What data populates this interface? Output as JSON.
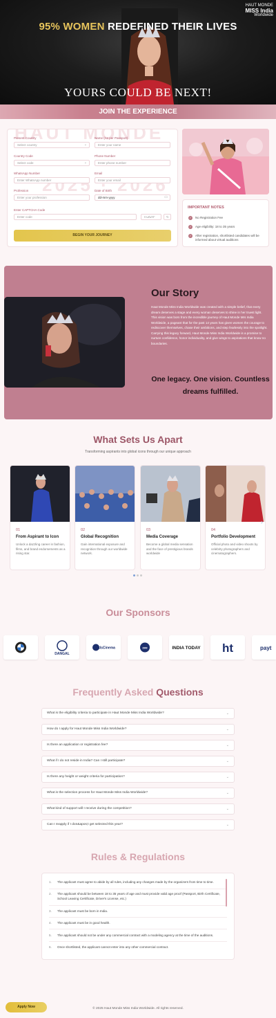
{
  "hero": {
    "headline_highlight": "95% WOMEN",
    "headline_rest": " REDEFINED THEIR LIVES",
    "tagline": "YOURS COULD BE NEXT!",
    "logo_small": "HAUT MONDE",
    "logo_main": "MISS India",
    "logo_sub": "Worldwide"
  },
  "join_banner": "JOIN THE EXPERIENCE",
  "form": {
    "watermark_line1": "HAUT MONDE",
    "watermark_line2": "2025 · 2026",
    "present_country_label": "Present Country",
    "present_country_value": "Select country",
    "name_label": "Name (As per Passport)",
    "name_placeholder": "Enter your name",
    "country_code_label": "Country Code",
    "country_code_value": "Select code",
    "phone_label": "Phone Number",
    "phone_placeholder": "Enter phone number",
    "whatsapp_label": "WhatsApp Number",
    "whatsapp_placeholder": "Enter WhatsApp number",
    "email_label": "Email",
    "email_placeholder": "Enter your email",
    "profession_label": "Profession",
    "profession_placeholder": "Enter your profession",
    "dob_label": "Date of Birth",
    "dob_placeholder": "dd-mm-yyyy",
    "captcha_label": "Enter CAPTCHA Code",
    "captcha_placeholder": "Enter code",
    "captcha_code": "UvZnYT",
    "submit_label": "BEGIN YOUR JOURNEY"
  },
  "notes": {
    "title": "IMPORTANT NOTES",
    "items": [
      "No Registration Fee",
      "Age eligibility: 18 to 35 years",
      "After registration, shortlisted candidates will be informed about virtual auditions"
    ]
  },
  "story": {
    "title": "Our Story",
    "paragraphs": [
      "Haut Monde Miss India Worldwide was created with a simple belief, that every dream deserves a stage and every woman deserves to shine in her truest light.",
      "This vision was born from the incredible journey of Haut Monde Mrs India Worldwide, a pageant that for the past 14 years has given women the courage to rediscover themselves, chase their ambitions, and step fearlessly into the spotlight.",
      "Carrying this legacy forward, Haut Monde Miss India Worldwide is a promise to nurture confidence, honor individuality, and give wings to aspirations that know no boundaries."
    ],
    "motto": "One legacy. One vision. Countless dreams fulfilled."
  },
  "features": {
    "title": "What Sets Us Apart",
    "subtitle": "Transforming aspirants into global icons through our unique approach",
    "cards": [
      {
        "num": "01",
        "title": "From Aspirant to Icon",
        "desc": "Unlock a dazzling career in fashion, films, and brand endorsements as a rising star."
      },
      {
        "num": "02",
        "title": "Global Recognition",
        "desc": "Gain international exposure and recognition through our worldwide network."
      },
      {
        "num": "03",
        "title": "Media Coverage",
        "desc": "Become a global media sensation and the face of prestigious brands worldwide"
      },
      {
        "num": "04",
        "title": "Portfolio Development",
        "desc": "Official photo and video shoots by celebrity photographers and cinematographers."
      }
    ]
  },
  "sponsors": {
    "title": "Our Sponsors",
    "logos": [
      "BMW",
      "DANGAL",
      "dsCinema",
      "zee",
      "INDIA TODAY",
      "ht",
      "payt"
    ]
  },
  "faq": {
    "title_light": "Frequently Asked ",
    "title_dark": "Questions",
    "items": [
      "What is the eligibility criteria to participate in Haut Monde Miss India Worldwide?",
      "How do I apply for Haut Monde Miss India Worldwide?",
      "Is there an application or registration fee?",
      "What if I do not reside in India? Can I still participate?",
      "Is there any height or weight criteria for participation?",
      "What is the selection process for Haut Monde Miss India Worldwide?",
      "What kind of support will I receive during the competition?",
      "Can I reapply if I don&apos;t get selected this year?"
    ]
  },
  "rules": {
    "title": "Rules & Regulations",
    "items": [
      {
        "n": "1.",
        "text": "The applicant must agree to abide by all rules, including any changes made by the organizers from time to time."
      },
      {
        "n": "2.",
        "text": "The applicant should be between 18 to 35 years of age and must provide valid age proof (Passport, Birth Certificate, School Leaving Certificate, Driver's License, etc.)"
      },
      {
        "n": "3.",
        "text": "The applicant must be born in India."
      },
      {
        "n": "4.",
        "text": "The applicant must be in good health."
      },
      {
        "n": "5.",
        "text": "The applicant should not be under any commercial contract with a modeling agency at the time of the auditions."
      },
      {
        "n": "6.",
        "text": "Once shortlisted, the applicant cannot enter into any other commercial contract."
      }
    ]
  },
  "footer": {
    "apply_label": "Apply Now",
    "copyright": "© 2025 Haut Monde Miss India Worldwide. All rights reserved."
  },
  "colors": {
    "accent": "#b05a6c",
    "rose": "#c07f90",
    "gold": "#e3c54d"
  }
}
